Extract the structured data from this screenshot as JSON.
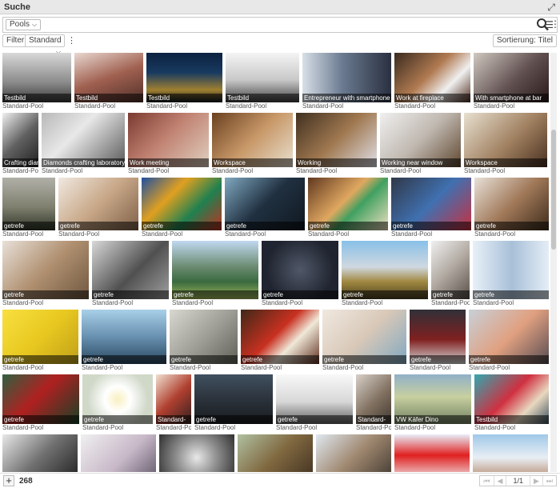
{
  "window": {
    "title": "Suche"
  },
  "search": {
    "pools_label": "Pools"
  },
  "filterbar": {
    "filter_label": "Filter",
    "standard_label": "Standard",
    "sort_label": "Sortierung: Titel"
  },
  "footer": {
    "count": "268",
    "page_indicator": "1/1"
  },
  "rows": [
    {
      "h": 62,
      "items": [
        {
          "w": 86,
          "title": "Testbild",
          "pool": "Standard-Pool",
          "bg": "linear-gradient(180deg,#d8d8d8,#8a8a8a 60%,#3a3a3a)"
        },
        {
          "w": 86,
          "title": "Testbild",
          "pool": "Standard-Pool",
          "bg": "linear-gradient(160deg,#e8d8d0,#a06050 50%,#50302a)"
        },
        {
          "w": 95,
          "title": "Testbild",
          "pool": "Standard-Pool",
          "bg": "linear-gradient(180deg,#0c2240,#183a60 40%,#a08030 75%,#101820)"
        },
        {
          "w": 92,
          "title": "Testbild",
          "pool": "Standard-Pool",
          "bg": "linear-gradient(180deg,#f4f4f4,#c8c8c8 55%,#404040)"
        },
        {
          "w": 111,
          "title": "Entrepreneur with smartphone",
          "pool": "Standard-Pool",
          "bg": "linear-gradient(90deg,#d8e0e8,#6a7a90 45%,#2a3040)"
        },
        {
          "w": 95,
          "title": "Work at fireplace",
          "pool": "Standard-Pool",
          "bg": "linear-gradient(135deg,#3a2a20,#b07a50 45%,#f0f0f0 70%,#503020)"
        },
        {
          "w": 95,
          "title": "With smartphone at bar",
          "pool": "Standard-Pool",
          "bg": "linear-gradient(135deg,#d0c8c0,#605050 55%,#281818)"
        }
      ]
    },
    {
      "h": 68,
      "items": [
        {
          "w": 45,
          "title": "Crafting diamond",
          "pool": "Standard-Pool",
          "bg": "linear-gradient(135deg,#f0f0f0,#606060 50%,#202020)"
        },
        {
          "w": 104,
          "title": "Diamonds crafting laboratory",
          "pool": "Standard-Pool",
          "bg": "linear-gradient(135deg,#b8b8b8,#e8e8e8 40%,#585858)"
        },
        {
          "w": 101,
          "title": "Work meeting",
          "pool": "Standard-Pool",
          "bg": "linear-gradient(135deg,#7a3a30,#c08070 45%,#e0d0c0)"
        },
        {
          "w": 101,
          "title": "Workspace",
          "pool": "Standard-Pool",
          "bg": "linear-gradient(135deg,#6a4020,#c89868 50%,#e8e0d0)"
        },
        {
          "w": 101,
          "title": "Working",
          "pool": "Standard-Pool",
          "bg": "linear-gradient(135deg,#403020,#a07850 50%,#e0e0e8)"
        },
        {
          "w": 101,
          "title": "Working near window",
          "pool": "Standard-Pool",
          "bg": "linear-gradient(135deg,#f0f0f0,#c0b8b0 50%,#604830)"
        },
        {
          "w": 104,
          "title": "Workspace",
          "pool": "Standard-Pool",
          "bg": "linear-gradient(135deg,#e8e0d0,#a08060 55%,#4a3020)"
        }
      ]
    },
    {
      "h": 66,
      "items": [
        {
          "w": 66,
          "title": "getrefe",
          "pool": "Standard-Pool",
          "bg": "linear-gradient(180deg,#b0b0a8,#808070 55%,#303828)"
        },
        {
          "w": 100,
          "title": "getrefe",
          "pool": "Standard-Pool",
          "bg": "linear-gradient(135deg,#f0e8e0,#c8a888 50%,#806048)"
        },
        {
          "w": 100,
          "title": "getrefe",
          "pool": "Standard-Pool",
          "bg": "linear-gradient(135deg,#2050a0,#e0a020 35%,#208050 65%,#c03020)"
        },
        {
          "w": 100,
          "title": "getrefe",
          "pool": "Standard-Pool",
          "bg": "linear-gradient(135deg,#80a8c0,#203040 50%,#101820)"
        },
        {
          "w": 100,
          "title": "getrefe",
          "pool": "Standard-Pool",
          "bg": "linear-gradient(135deg,#603820,#e0a860 45%,#40a060 60%,#f0e0c0)"
        },
        {
          "w": 100,
          "title": "getrefe",
          "pool": "Standard-Pool",
          "bg": "linear-gradient(135deg,#303848,#4070b0 50%,#c83040)"
        },
        {
          "w": 97,
          "title": "getrefe",
          "pool": "Standard-Pool",
          "bg": "linear-gradient(135deg,#e8e0d8,#a07858 50%,#382818)"
        }
      ]
    },
    {
      "h": 73,
      "items": [
        {
          "w": 108,
          "title": "getrefe",
          "pool": "Standard-Pool",
          "bg": "linear-gradient(135deg,#e8e0d8,#b09070 50%,#705840)"
        },
        {
          "w": 96,
          "title": "getrefe",
          "pool": "Standard-Pool",
          "bg": "linear-gradient(135deg,#d8d8d8,#505050 55%,#a0a0a0)"
        },
        {
          "w": 108,
          "title": "getrefe",
          "pool": "Standard-Pool",
          "bg": "linear-gradient(180deg,#c0d8f0,#6a8a70 45%,#3a6a40 70%,#a0b858)"
        },
        {
          "w": 96,
          "title": "getrefe",
          "pool": "Standard-Pool",
          "bg": "radial-gradient(circle,#505868,#202430 70%)"
        },
        {
          "w": 108,
          "title": "getrefe",
          "pool": "Standard-Pool",
          "bg": "linear-gradient(180deg,#88c0e8,#d0d8e0 45%,#a08840 70%,#4a4020)"
        },
        {
          "w": 48,
          "title": "getrefe",
          "pool": "Standard-Pool",
          "bg": "linear-gradient(135deg,#f0f0f0,#b0a8a0 50%,#585048)"
        },
        {
          "w": 98,
          "title": "getrefe",
          "pool": "Standard-Pool",
          "bg": "linear-gradient(90deg,#e8f0f8,#a8c0d8 50%,#e8f0f8)"
        }
      ]
    },
    {
      "h": 68,
      "items": [
        {
          "w": 95,
          "title": "getrefe",
          "pool": "Standard-Pool",
          "bg": "linear-gradient(135deg,#f8e040,#e8c820 50%,#c0a018)"
        },
        {
          "w": 106,
          "title": "getrefe",
          "pool": "Standard-Pool",
          "bg": "linear-gradient(180deg,#a8d0e8,#6890b0 50%,#2a4860)"
        },
        {
          "w": 85,
          "title": "getrefe",
          "pool": "Standard-Pool",
          "bg": "linear-gradient(135deg,#d8d8d0,#a0a098 50%,#606058)"
        },
        {
          "w": 98,
          "title": "getrefe",
          "pool": "Standard-Pool",
          "bg": "linear-gradient(135deg,#402818,#c83020 45%,#f0e8d8 65%,#603020)"
        },
        {
          "w": 105,
          "title": "getrefe",
          "pool": "Standard-Pool",
          "bg": "linear-gradient(135deg,#f0e8e0,#d8c8b8 50%,#80a8c0)"
        },
        {
          "w": 70,
          "title": "getrefe",
          "pool": "Standard-Pool",
          "bg": "linear-gradient(180deg,#303038,#802020 55%,#d8d8d8)"
        },
        {
          "w": 104,
          "title": "getrefe",
          "pool": "Standard-Pool",
          "bg": "linear-gradient(135deg,#c8d0d8,#e0a080 50%,#504850)"
        }
      ]
    },
    {
      "h": 62,
      "items": [
        {
          "w": 96,
          "title": "getrefe",
          "pool": "Standard-Pool",
          "bg": "linear-gradient(135deg,#306040,#b02020 45%,#184028)"
        },
        {
          "w": 88,
          "title": "getrefe",
          "pool": "Standard-Pool",
          "bg": "radial-gradient(circle,#f8f0c0,#ffffff 30%,#d0d8c8 70%)"
        },
        {
          "w": 44,
          "title": "Standard-",
          "pool": "Standard-Pool",
          "bg": "linear-gradient(135deg,#f0e0d0,#b04030 50%,#302020)"
        },
        {
          "w": 98,
          "title": "getrefe",
          "pool": "Standard-Pool",
          "bg": "linear-gradient(180deg,#405060,#2a3038 55%,#181c20)"
        },
        {
          "w": 96,
          "title": "getrefe",
          "pool": "Standard-Pool",
          "bg": "linear-gradient(180deg,#f8f8f8,#d8d8d8 55%,#606060)"
        },
        {
          "w": 44,
          "title": "Standard-",
          "pool": "Standard-Pool",
          "bg": "linear-gradient(135deg,#d8d0c8,#807060 55%,#403830)"
        },
        {
          "w": 96,
          "title": "VW Käfer Dino",
          "pool": "Standard-Pool",
          "bg": "linear-gradient(180deg,#90b0c8,#c8d0a0 45%,#708060)"
        },
        {
          "w": 96,
          "title": "Testbild",
          "pool": "Standard-Pool",
          "bg": "linear-gradient(135deg,#30a8b0,#d03040 45%,#e8d8c0 70%,#304858)"
        }
      ]
    },
    {
      "h": 58,
      "items": [
        {
          "w": 94,
          "title": "",
          "pool": "",
          "bg": "linear-gradient(135deg,#e8e8e8,#707070 50%,#202020)"
        },
        {
          "w": 94,
          "title": "",
          "pool": "",
          "bg": "linear-gradient(135deg,#f0f0f0,#c8b8c8 55%,#605868)"
        },
        {
          "w": 94,
          "title": "",
          "pool": "",
          "bg": "radial-gradient(circle,#e8e8e8,#909090 45%,#303030)"
        },
        {
          "w": 94,
          "title": "",
          "pool": "",
          "bg": "linear-gradient(135deg,#b0c0a0,#806840 50%,#403020)"
        },
        {
          "w": 94,
          "title": "",
          "pool": "",
          "bg": "linear-gradient(135deg,#e0e8f0,#a08870 50%,#403830)"
        },
        {
          "w": 94,
          "title": "",
          "pool": "",
          "bg": "linear-gradient(180deg,#e8eef8,#e02020 45%,#f0f0f0)"
        },
        {
          "w": 94,
          "title": "",
          "pool": "",
          "bg": "linear-gradient(180deg,#a0c8e8,#e8eef4 50%,#b08060)"
        }
      ]
    }
  ]
}
